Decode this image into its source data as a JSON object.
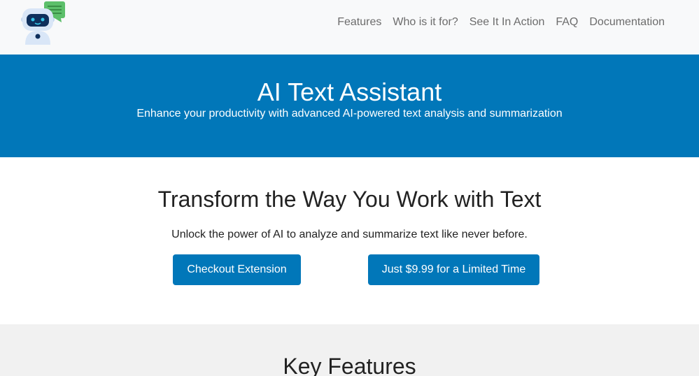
{
  "nav": {
    "logo_alt": "AI Text Assistant robot logo",
    "links": [
      "Features",
      "Who is it for?",
      "See It In Action",
      "FAQ",
      "Documentation"
    ]
  },
  "hero": {
    "title": "AI Text Assistant",
    "subtitle": "Enhance your productivity with advanced AI-powered text analysis and summarization"
  },
  "intro": {
    "title": "Transform the Way You Work with Text",
    "text": "Unlock the power of AI to analyze and summarize text like never before.",
    "checkout_label": "Checkout Extension",
    "price_label": "Just $9.99 for a Limited Time"
  },
  "features": {
    "title": "Key Features"
  },
  "colors": {
    "brand": "#0177b9",
    "nav_bg": "#f8f9fa",
    "features_bg": "#f1f1f1"
  }
}
